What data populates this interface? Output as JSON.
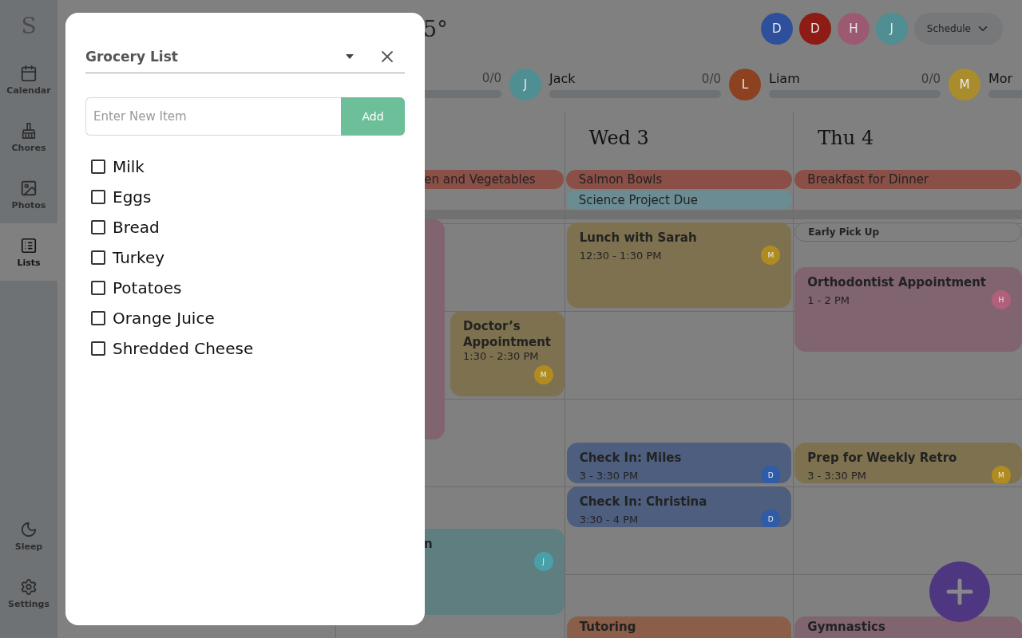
{
  "sidebar": {
    "logo": "S",
    "items": [
      {
        "label": "Calendar",
        "selected": false
      },
      {
        "label": "Chores",
        "selected": false
      },
      {
        "label": "Photos",
        "selected": false
      },
      {
        "label": "Lists",
        "selected": true
      }
    ],
    "bottom_items": [
      {
        "label": "Sleep",
        "selected": false
      },
      {
        "label": "Settings",
        "selected": false
      }
    ]
  },
  "header": {
    "temperature": "5°",
    "members": [
      {
        "initial": "D",
        "color": "#2e509c"
      },
      {
        "initial": "D",
        "color": "#8c1c14"
      },
      {
        "initial": "H",
        "color": "#9c5a72"
      },
      {
        "initial": "J",
        "color": "#4f8e92"
      }
    ],
    "view_button": "Schedule"
  },
  "chores": [
    {
      "count": "0/0",
      "level": 0
    },
    {
      "name": "Jack",
      "initial": "J",
      "color": "#4f8e92",
      "count": "0/0",
      "level": 0
    },
    {
      "name": "Liam",
      "initial": "L",
      "color": "#8c4220",
      "count": "0/0",
      "level": 0
    },
    {
      "name": "Mor",
      "initial": "M",
      "color": "#a98c2c",
      "level": 0
    }
  ],
  "columns": [
    {
      "all_day": [
        {
          "title": "en and Vegetables",
          "color": "#8a5048"
        }
      ],
      "events": [
        {
          "kind": "card",
          "color": "#806470"
        },
        {
          "kind": "card",
          "title": "Doctor’s Appointment",
          "time": "1:30 - 2:30 PM",
          "color": "#7e7150",
          "member": {
            "initial": "M",
            "color": "#b08c20"
          }
        },
        {
          "kind": "card",
          "title": "n",
          "color": "#5e7e80",
          "member": {
            "initial": "J",
            "color": "#4aa0a8"
          }
        }
      ]
    },
    {
      "label": "Wed 3",
      "all_day": [
        {
          "title": "Salmon Bowls",
          "color": "#8a5048"
        },
        {
          "title": "Science Project Due",
          "color": "#6a8c92"
        }
      ],
      "events": [
        {
          "kind": "card",
          "title": "Lunch with Sarah",
          "time": "12:30 - 1:30 PM",
          "color": "#7e7150",
          "member": {
            "initial": "M",
            "color": "#b08c20"
          }
        },
        {
          "kind": "card",
          "title": "Check In: Miles",
          "time": "3 - 3:30 PM",
          "color": "#4e5e7e",
          "member": {
            "initial": "D",
            "color": "#2e5ca8"
          }
        },
        {
          "kind": "card",
          "title": "Check In: Christina",
          "time": "3:30 - 4 PM",
          "color": "#4e5e7e",
          "member": {
            "initial": "D",
            "color": "#2e5ca8"
          }
        },
        {
          "kind": "card",
          "title": "Tutoring",
          "color": "#8a5e48"
        }
      ]
    },
    {
      "label": "Thu 4",
      "all_day": [
        {
          "title": "Breakfast for Dinner",
          "color": "#8a5048"
        }
      ],
      "events": [
        {
          "kind": "outline",
          "title": "Early Pick Up"
        },
        {
          "kind": "card",
          "title": "Orthodontist Appointment",
          "time": "1 - 2 PM",
          "color": "#806470",
          "member": {
            "initial": "H",
            "color": "#b0607a"
          }
        },
        {
          "kind": "card",
          "title": "Prep for Weekly Retro",
          "time": "3 - 3:30 PM",
          "color": "#7e7150",
          "member": {
            "initial": "M",
            "color": "#b08c20"
          }
        },
        {
          "kind": "card",
          "title": "Gymnastics",
          "color": "#806470"
        }
      ]
    }
  ],
  "modal": {
    "title": "Grocery List",
    "input": {
      "placeholder": "Enter New Item"
    },
    "add_button": "Add",
    "items": [
      {
        "label": "Milk",
        "checked": false
      },
      {
        "label": "Eggs",
        "checked": false
      },
      {
        "label": "Bread",
        "checked": false
      },
      {
        "label": "Turkey",
        "checked": false
      },
      {
        "label": "Potatoes",
        "checked": false
      },
      {
        "label": "Orange Juice",
        "checked": false
      },
      {
        "label": "Shredded Cheese",
        "checked": false
      }
    ]
  }
}
